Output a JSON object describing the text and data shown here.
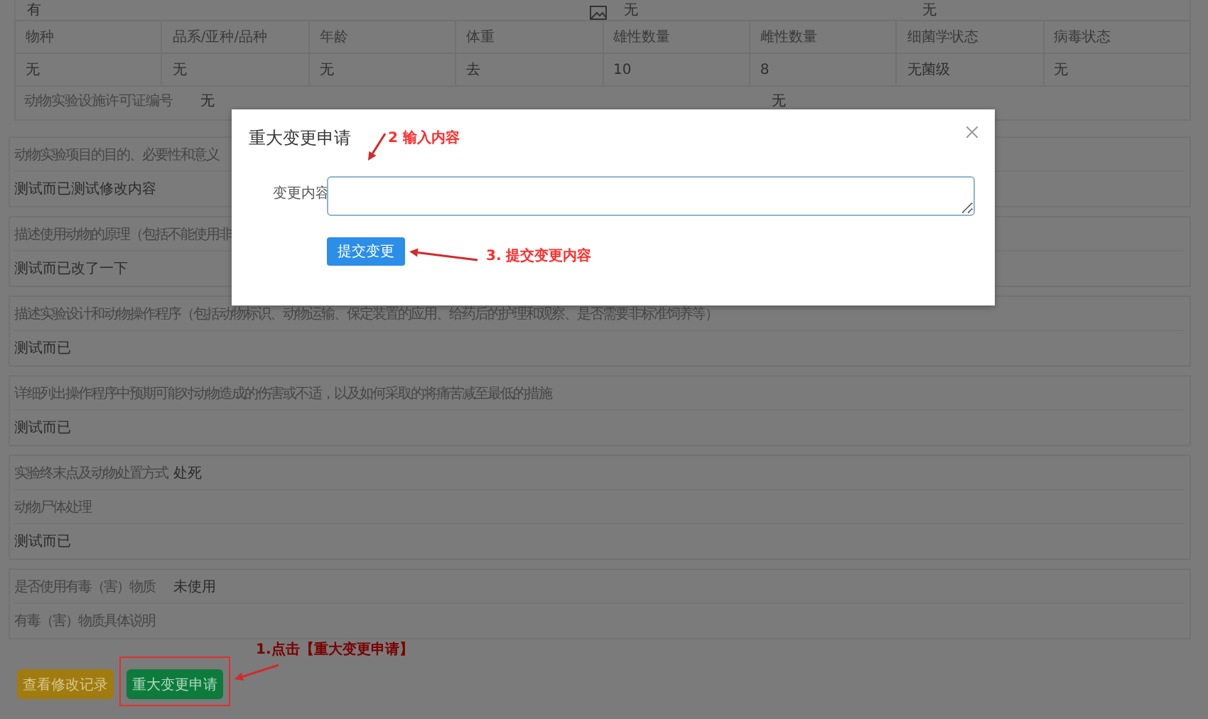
{
  "top_row": {
    "values": [
      "有",
      "无",
      "无"
    ]
  },
  "species_table": {
    "columns": [
      "物种",
      "品系/亚种/品种",
      "年龄",
      "体重",
      "雄性数量",
      "雌性数量",
      "细菌学状态",
      "病毒状态"
    ],
    "rows": [
      [
        "无",
        "无",
        "无",
        "去",
        "10",
        "8",
        "无菌级",
        "无"
      ]
    ]
  },
  "license_row": {
    "label": "动物实验设施许可证编号",
    "value": "无",
    "value_2": "无"
  },
  "sections": [
    {
      "rows": [
        {
          "kind": "label",
          "text": "动物实验项目的目的、必要性和意义"
        },
        {
          "kind": "value",
          "text": "测试而已测试修改内容"
        }
      ]
    },
    {
      "rows": [
        {
          "kind": "label",
          "text": "描述使用动物的原理（包括不能使用非"
        },
        {
          "kind": "value",
          "text": "测试而已改了一下"
        }
      ]
    },
    {
      "rows": [
        {
          "kind": "label",
          "text": "描述实验设计和动物操作程序（包括动物标识、动物运输、保定装置的应用、给药后的护理和观察、是否需要非标准饲养等）"
        },
        {
          "kind": "value",
          "text": "测试而已"
        }
      ]
    },
    {
      "rows": [
        {
          "kind": "label",
          "text": "详细列出操作程序中预期可能对动物造成的伤害或不适，以及如何采取的将痛苦减至最低的措施"
        },
        {
          "kind": "value",
          "text": "测试而已"
        }
      ]
    },
    {
      "rows": [
        {
          "kind": "pair",
          "text": "实验终末点及动物处置方式",
          "value": "处死"
        },
        {
          "kind": "label",
          "text": "动物尸体处理"
        },
        {
          "kind": "value",
          "text": "测试而已"
        }
      ]
    },
    {
      "rows": [
        {
          "kind": "pair",
          "text": "是否使用有毒（害）物质",
          "value": "未使用"
        },
        {
          "kind": "label",
          "text": "有毒（害）物质具体说明"
        }
      ]
    }
  ],
  "buttons": [
    {
      "label": "查看修改记录",
      "kind": "warning"
    },
    {
      "label": "重大变更申请",
      "kind": "success"
    }
  ],
  "dialog": {
    "title": "重大变更申请",
    "field_label": "变更内容",
    "submit": "提交变更"
  },
  "annotations": [
    {
      "kind": "dialog_field",
      "text": "2 输入内容"
    },
    {
      "kind": "dialog_submit",
      "text": "3. 提交变更内容"
    },
    {
      "kind": "page_button",
      "text": "1.点击【重大变更申请】"
    }
  ]
}
